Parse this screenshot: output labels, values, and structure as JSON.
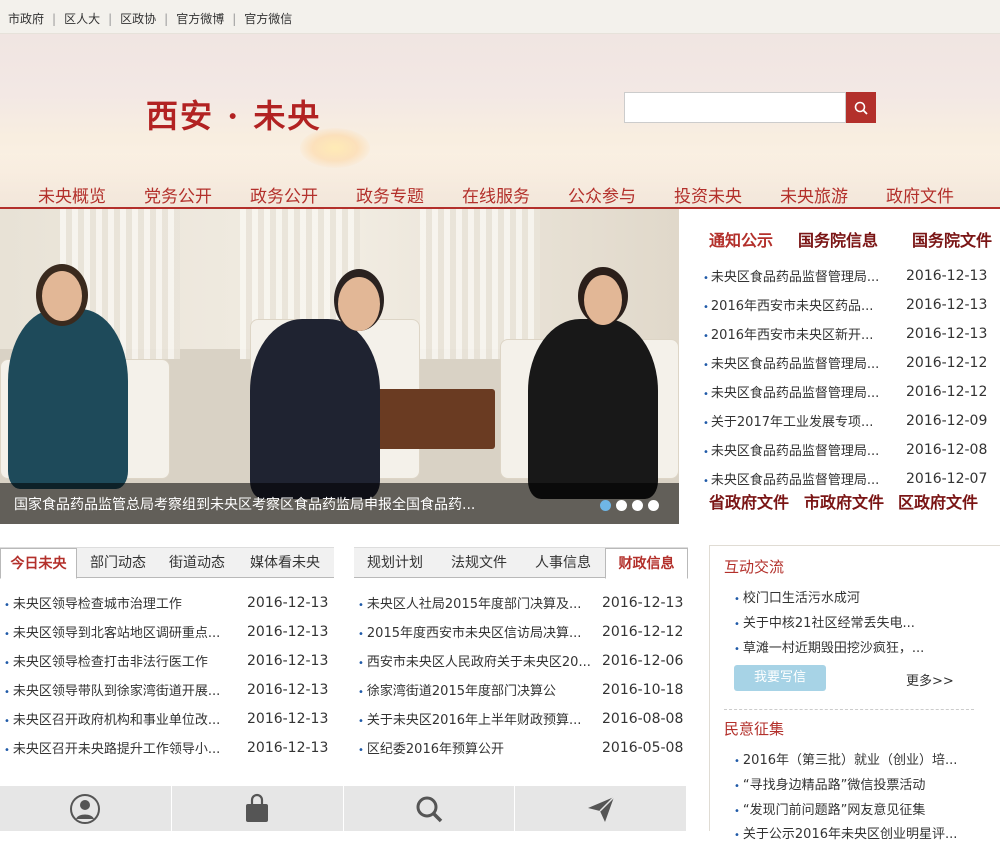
{
  "topbar": {
    "links": [
      "市政府",
      "区人大",
      "区政协",
      "官方微博",
      "官方微信"
    ]
  },
  "header": {
    "title": "西安 · 未央"
  },
  "search": {
    "placeholder": ""
  },
  "nav": {
    "items": [
      "未央概览",
      "党务公开",
      "政务公开",
      "政务专题",
      "在线服务",
      "公众参与",
      "投资未央",
      "未央旅游",
      "政府文件"
    ]
  },
  "slider": {
    "caption": "国家食品药品监管总局考察组到未央区考察区食品药监局申报全国食品药...",
    "active_dot": 0,
    "dot_count": 4
  },
  "notice": {
    "tabs": [
      "通知公示",
      "国务院信息",
      "国务院文件"
    ],
    "items": [
      {
        "title": "未央区食品药品监督管理局...",
        "date": "2016-12-13"
      },
      {
        "title": "2016年西安市未央区药品...",
        "date": "2016-12-13"
      },
      {
        "title": "2016年西安市未央区新开...",
        "date": "2016-12-13"
      },
      {
        "title": "未央区食品药品监督管理局...",
        "date": "2016-12-12"
      },
      {
        "title": "未央区食品药品监督管理局...",
        "date": "2016-12-12"
      },
      {
        "title": "关于2017年工业发展专项...",
        "date": "2016-12-09"
      },
      {
        "title": "未央区食品药品监督管理局...",
        "date": "2016-12-08"
      },
      {
        "title": "未央区食品药品监督管理局...",
        "date": "2016-12-07"
      }
    ],
    "bottom_tabs": [
      "省政府文件",
      "市政府文件",
      "区政府文件"
    ]
  },
  "news1": {
    "tabs": [
      "今日未央",
      "部门动态",
      "街道动态",
      "媒体看未央"
    ],
    "items": [
      {
        "title": "未央区领导检查城市治理工作",
        "date": "2016-12-13"
      },
      {
        "title": "未央区领导到北客站地区调研重点...",
        "date": "2016-12-13"
      },
      {
        "title": "未央区领导检查打击非法行医工作",
        "date": "2016-12-13"
      },
      {
        "title": "未央区领导带队到徐家湾街道开展...",
        "date": "2016-12-13"
      },
      {
        "title": "未央区召开政府机构和事业单位改...",
        "date": "2016-12-13"
      },
      {
        "title": "未央区召开未央路提升工作领导小...",
        "date": "2016-12-13"
      }
    ]
  },
  "news2": {
    "tabs": [
      "规划计划",
      "法规文件",
      "人事信息",
      "财政信息"
    ],
    "items": [
      {
        "title": "未央区人社局2015年度部门决算及...",
        "date": "2016-12-13"
      },
      {
        "title": "2015年度西安市未央区信访局决算...",
        "date": "2016-12-12"
      },
      {
        "title": "西安市未央区人民政府关于未央区20...",
        "date": "2016-12-06"
      },
      {
        "title": "徐家湾街道2015年度部门决算公",
        "date": "2016-10-18"
      },
      {
        "title": "关于未央区2016年上半年财政预算...",
        "date": "2016-08-08"
      },
      {
        "title": "区纪委2016年预算公开",
        "date": "2016-05-08"
      }
    ]
  },
  "interaction": {
    "title": "互动交流",
    "items": [
      "校门口生活污水成河",
      "关于中核21社区经常丢失电...",
      "草滩一村近期毁田挖沙疯狂，..."
    ],
    "write_label": "我要写信",
    "more_label": "更多>>"
  },
  "opinion": {
    "title": "民意征集",
    "items": [
      "2016年（第三批）就业（创业）培...",
      "“寻找身边精品路”微信投票活动",
      "“发现门前问题路”网友意见征集",
      "关于公示2016年未央区创业明星评..."
    ]
  },
  "bottom_icons": [
    "user-icon",
    "bag-icon",
    "search-icon",
    "send-icon"
  ],
  "colors": {
    "brand_red": "#b3302b",
    "bullet_blue": "#1f5aa8",
    "dot_active": "#6fb6e6"
  }
}
